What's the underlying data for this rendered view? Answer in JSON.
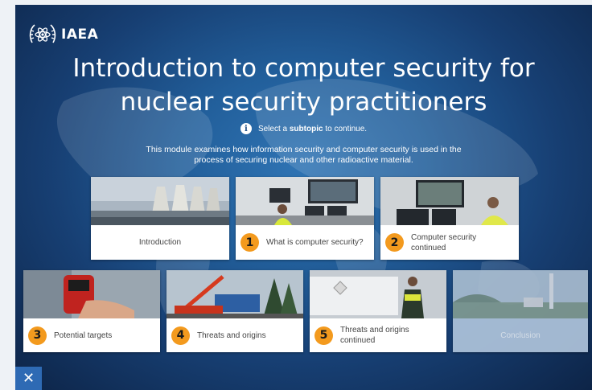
{
  "brand": {
    "logo_text": "IAEA"
  },
  "module": {
    "title_line1": "Introduction to computer security for",
    "title_line2": "nuclear security practitioners",
    "hint_prefix": "Select a",
    "hint_bold": "subtopic",
    "hint_suffix": "to continue.",
    "description": "This module examines how information security and computer security is used in the process of securing nuclear and other radioactive material."
  },
  "subtopics": [
    {
      "number": "",
      "label": "Introduction"
    },
    {
      "number": "1",
      "label": "What is computer security?"
    },
    {
      "number": "2",
      "label": "Computer security continued"
    },
    {
      "number": "3",
      "label": "Potential targets"
    },
    {
      "number": "4",
      "label": "Threats and origins"
    },
    {
      "number": "5",
      "label": "Threats and origins continued"
    },
    {
      "number": "",
      "label": "Conclusion"
    }
  ],
  "controls": {
    "close_symbol": "✕"
  },
  "colors": {
    "badge": "#f39a1e",
    "background": "#1f5a96",
    "close_button": "#2e6ab4"
  }
}
